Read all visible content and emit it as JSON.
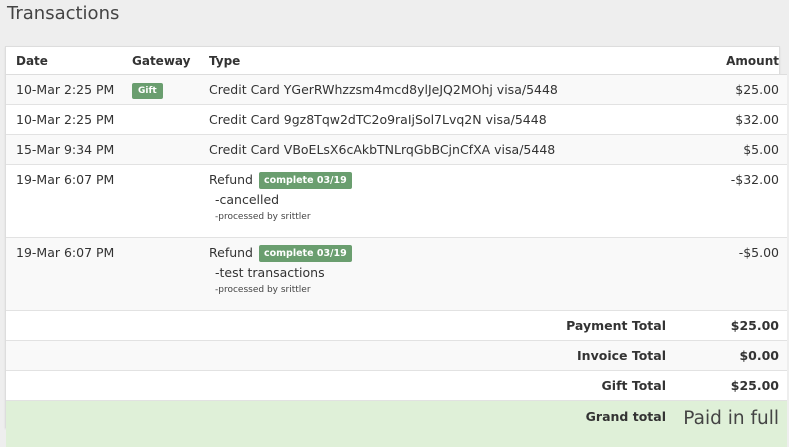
{
  "page": {
    "title": "Transactions"
  },
  "table": {
    "headers": {
      "date": "Date",
      "gateway": "Gateway",
      "type": "Type",
      "amount": "Amount"
    },
    "rows": [
      {
        "date": "10-Mar 2:25 PM",
        "gateway": "Gift",
        "type": "Credit Card YGerRWhzzsm4mcd8ylJeJQ2MOhj visa/5448",
        "amount": "$25.00"
      },
      {
        "date": "10-Mar 2:25 PM",
        "gateway": "",
        "type": "Credit Card 9gz8Tqw2dTC2o9raIjSol7Lvq2N visa/5448",
        "amount": "$32.00"
      },
      {
        "date": "15-Mar 9:34 PM",
        "gateway": "",
        "type": "Credit Card VBoELsX6cAkbTNLrqGbBCjnCfXA visa/5448",
        "amount": "$5.00"
      }
    ],
    "refunds": [
      {
        "date": "19-Mar 6:07 PM",
        "type": "Refund",
        "status": "complete 03/19",
        "note": "-cancelled",
        "processed": "-processed by srittler",
        "amount": "-$32.00"
      },
      {
        "date": "19-Mar 6:07 PM",
        "type": "Refund",
        "status": "complete 03/19",
        "note": "-test transactions",
        "processed": "-processed by srittler",
        "amount": "-$5.00"
      }
    ]
  },
  "totals": {
    "payment_label": "Payment Total",
    "payment_value": "$25.00",
    "invoice_label": "Invoice Total",
    "invoice_value": "$0.00",
    "gift_label": "Gift Total",
    "gift_value": "$25.00",
    "grand_label": "Grand total",
    "grand_value": "Paid in full"
  },
  "colors": {
    "badge": "#6a9e6f",
    "grand_row": "#dff0d8",
    "background": "#eeeeee"
  }
}
